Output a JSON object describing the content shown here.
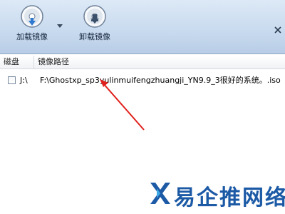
{
  "toolbar": {
    "load_label": "加载镜像",
    "unload_label": "卸载镜像"
  },
  "list": {
    "columns": [
      "磁盘",
      "镜像路径"
    ],
    "rows": [
      {
        "drive": "J:\\",
        "path": "F:\\Ghostxp_sp3yulinmuifengzhuangji_YN9.9_3很好的系统。.iso",
        "checked": false
      }
    ]
  },
  "watermark": {
    "text": "易企推网络"
  },
  "colors": {
    "accent_blue": "#1c5aa6",
    "annotation_red": "#e0201c"
  }
}
